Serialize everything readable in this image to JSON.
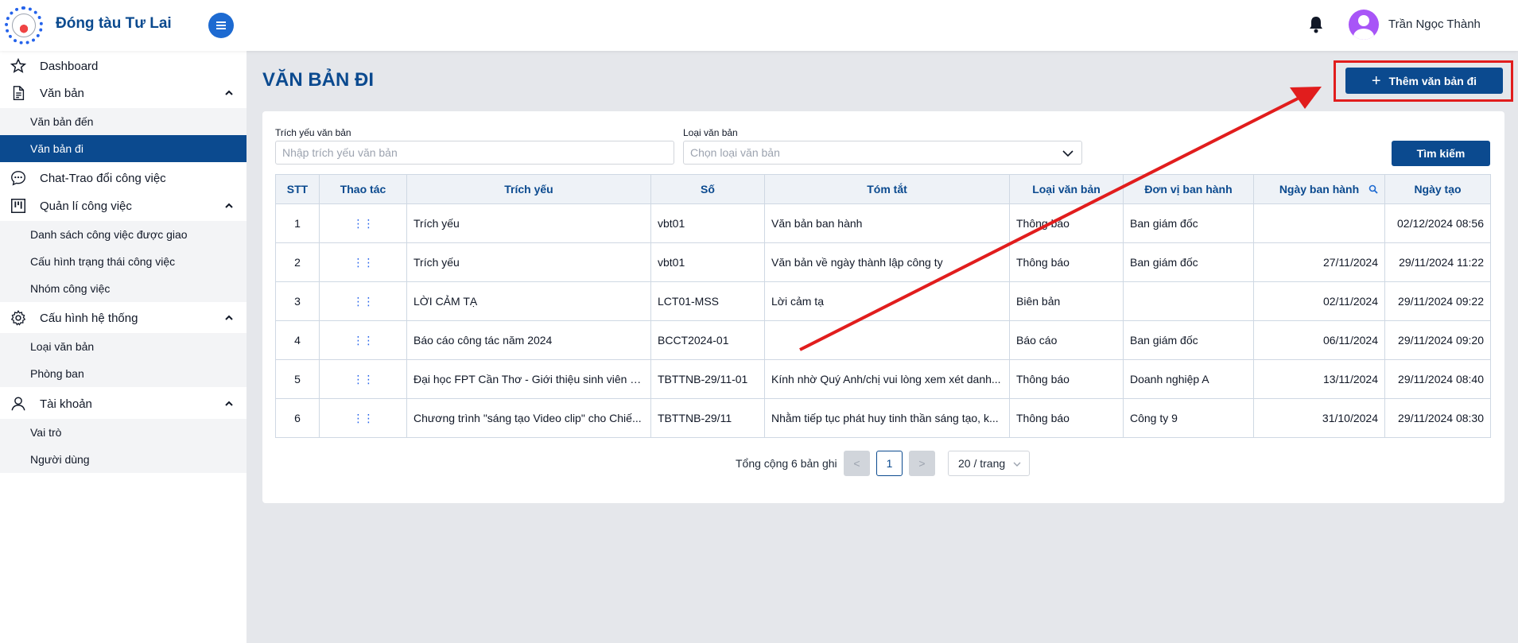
{
  "app": {
    "brand": "Đóng tàu Tư Lai",
    "user_name": "Trần Ngọc Thành"
  },
  "sidebar": {
    "dashboard": "Dashboard",
    "van_ban": {
      "label": "Văn bản",
      "items": [
        "Văn bản đến",
        "Văn bản đi"
      ]
    },
    "chat": "Chat-Trao đổi công việc",
    "quan_li": {
      "label": "Quản lí công việc",
      "items": [
        "Danh sách công việc được giao",
        "Cấu hình trạng thái công việc",
        "Nhóm công việc"
      ]
    },
    "cau_hinh": {
      "label": "Cấu hình hệ thống",
      "items": [
        "Loại văn bản",
        "Phòng ban"
      ]
    },
    "tai_khoan": {
      "label": "Tài khoản",
      "items": [
        "Vai trò",
        "Người dùng"
      ]
    }
  },
  "page": {
    "title": "VĂN BẢN ĐI",
    "add_button": "Thêm văn bản đi"
  },
  "filters": {
    "trich_yeu_label": "Trích yếu văn bản",
    "trich_yeu_placeholder": "Nhập trích yếu văn bản",
    "loai_label": "Loại văn bản",
    "loai_placeholder": "Chọn loại văn bản",
    "search_button": "Tìm kiếm"
  },
  "table": {
    "headers": [
      "STT",
      "Thao tác",
      "Trích yếu",
      "Số",
      "Tóm tắt",
      "Loại văn bản",
      "Đơn vị ban hành",
      "Ngày ban hành",
      "Ngày tạo"
    ],
    "rows": [
      [
        "1",
        "⋮⋮",
        "Trích yếu",
        "vbt01",
        "Văn bản ban hành",
        "Thông báo",
        "Ban giám đốc",
        "",
        "02/12/2024 08:56"
      ],
      [
        "2",
        "⋮⋮",
        "Trích yếu",
        "vbt01",
        "Văn bản về ngày thành lập công ty",
        "Thông báo",
        "Ban giám đốc",
        "27/11/2024",
        "29/11/2024 11:22"
      ],
      [
        "3",
        "⋮⋮",
        "LỜI CẢM TẠ",
        "LCT01-MSS",
        "Lời cảm tạ",
        "Biên bản",
        "",
        "02/11/2024",
        "29/11/2024 09:22"
      ],
      [
        "4",
        "⋮⋮",
        "Báo cáo công tác năm 2024",
        "BCCT2024-01",
        "",
        "Báo cáo",
        "Ban giám đốc",
        "06/11/2024",
        "29/11/2024 09:20"
      ],
      [
        "5",
        "⋮⋮",
        "Đại học FPT Cần Thơ - Giới thiệu sinh viên OJ...",
        "TBTTNB-29/11-01",
        "Kính nhờ Quý Anh/chị vui lòng xem xét danh...",
        "Thông báo",
        "Doanh nghiệp A",
        "13/11/2024",
        "29/11/2024 08:40"
      ],
      [
        "6",
        "⋮⋮",
        "Chương trình \"sáng tạo Video clip\" cho Chiế...",
        "TBTTNB-29/11",
        "Nhằm tiếp tục phát huy tinh thần sáng tạo, k...",
        "Thông báo",
        "Công ty 9",
        "31/10/2024",
        "29/11/2024 08:30"
      ]
    ]
  },
  "pagination": {
    "total": "Tổng cộng 6 bản ghi",
    "prev": "<",
    "current": "1",
    "next": ">",
    "page_size": "20 / trang"
  },
  "colors": {
    "primary": "#0b4a8f",
    "highlight": "#e11d1d"
  }
}
